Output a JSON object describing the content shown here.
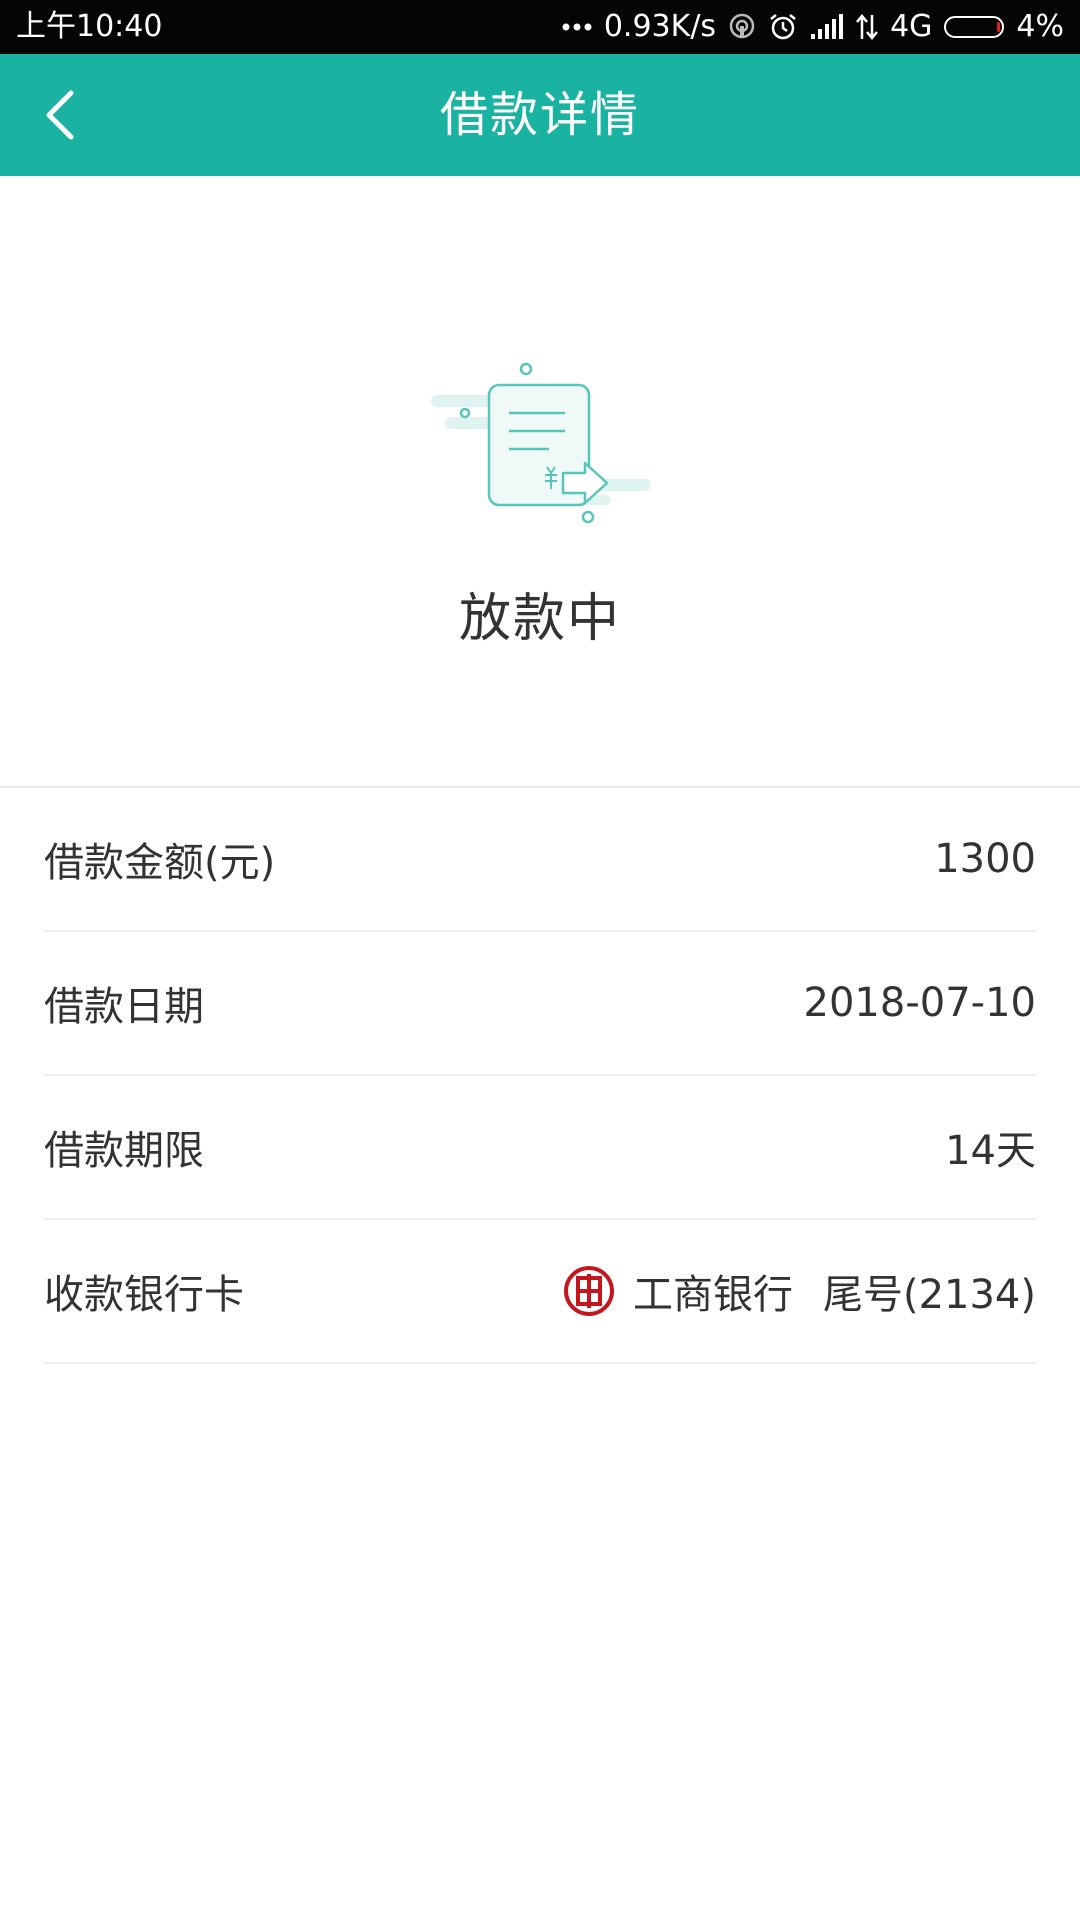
{
  "status_bar": {
    "time": "上午10:40",
    "network_speed": "0.93K/s",
    "network_type": "4G",
    "battery": "4%",
    "icons": [
      "dots-icon",
      "hotspot-icon",
      "alarm-icon",
      "signal-icon",
      "data-arrows-icon",
      "battery-icon"
    ],
    "battery_color": "#e02020"
  },
  "header": {
    "title": "借款详情",
    "back_icon": "chevron-left-icon",
    "background_color": "#1ab2a0"
  },
  "status": {
    "text": "放款中",
    "icon": "document-transfer-icon"
  },
  "details": [
    {
      "label": "借款金额(元)",
      "value": "1300"
    },
    {
      "label": "借款日期",
      "value": "2018-07-10"
    },
    {
      "label": "借款期限",
      "value": "14天"
    },
    {
      "label": "收款银行卡",
      "bank_name": "工商银行",
      "card_tail": "尾号(2134)",
      "bank_icon": "icbc-logo-icon",
      "bank_color": "#c4161c"
    }
  ]
}
